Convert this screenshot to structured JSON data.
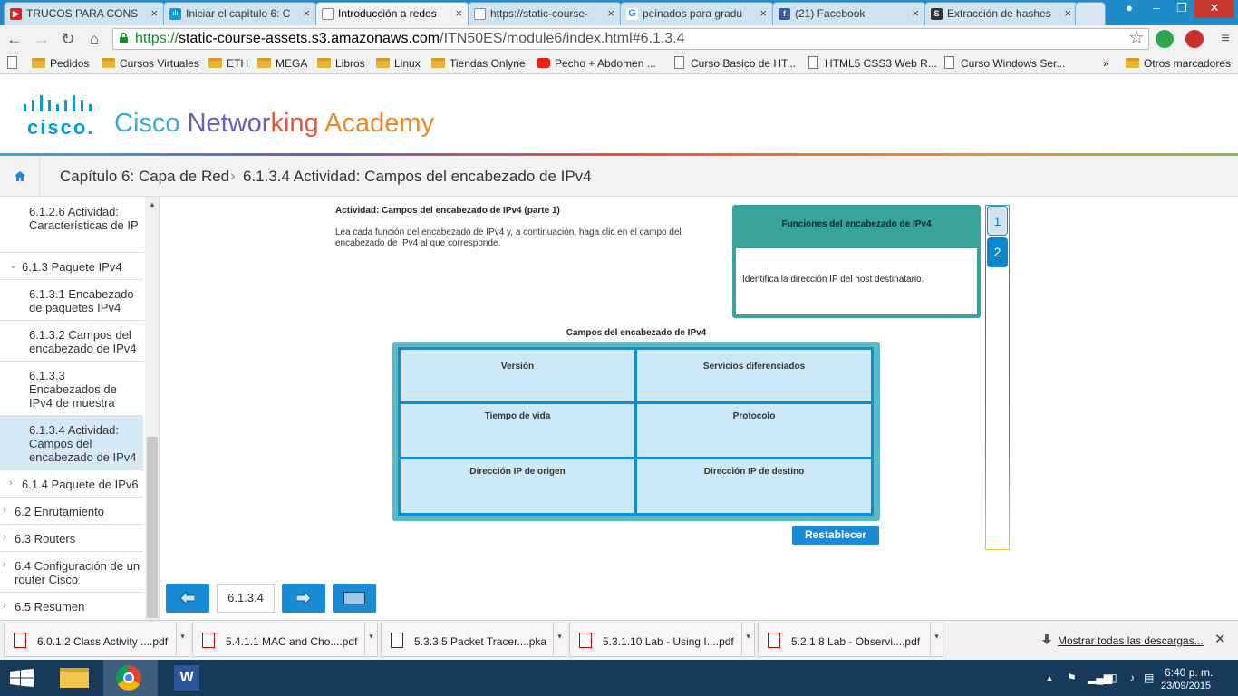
{
  "tabs": [
    {
      "label": "TRUCOS PARA CONS",
      "icon": "youtube-icon"
    },
    {
      "label": "Iniciar el capítulo 6: C",
      "icon": "cisco-icon"
    },
    {
      "label": "Introducción a redes",
      "icon": "page-icon"
    },
    {
      "label": "https://static-course-",
      "icon": "page-icon"
    },
    {
      "label": "peinados para gradu",
      "icon": "google-icon"
    },
    {
      "label": "(21) Facebook",
      "icon": "facebook-icon"
    },
    {
      "label": "Extracción de hashes",
      "icon": "s-icon"
    }
  ],
  "address": {
    "scheme": "https://",
    "host": "static-course-assets.s3.amazonaws.com",
    "path": "/ITN50ES/module6/index.html#6.1.3.4"
  },
  "bookmarks": [
    "Pedidos",
    "Cursos Virtuales",
    "ETH",
    "MEGA",
    "Libros",
    "Linux",
    "Tiendas Onlyne",
    "Pecho + Abdomen ...",
    "Curso Basico de HT...",
    "HTML5 CSS3 Web R...",
    "Curso Windows Ser...",
    "»",
    "Otros marcadores"
  ],
  "header": {
    "logo_text": "cisco.",
    "title_parts": [
      "Cisco ",
      "Networ",
      "king ",
      "Academy"
    ]
  },
  "breadcrumb": {
    "chapter": "Capítulo 6: Capa de Red",
    "separator": "›",
    "current": "6.1.3.4 Actividad: Campos del encabezado de IPv4"
  },
  "sidebar": [
    {
      "label": "6.1.2.6 Actividad: Características de IP",
      "level": 2
    },
    {
      "label": "6.1.3 Paquete IPv4",
      "level": 1,
      "chevron": "⌄"
    },
    {
      "label": "6.1.3.1 Encabezado de paquetes IPv4",
      "level": 2
    },
    {
      "label": "6.1.3.2 Campos del encabezado de IPv4",
      "level": 2
    },
    {
      "label": "6.1.3.3 Encabezados de IPv4 de muestra",
      "level": 2
    },
    {
      "label": "6.1.3.4 Actividad: Campos del encabezado de IPv4",
      "level": 2,
      "active": true
    },
    {
      "label": "6.1.4 Paquete de IPv6",
      "level": 1,
      "chevron": "›"
    },
    {
      "label": "6.2 Enrutamiento",
      "level": 0,
      "chevron": "›"
    },
    {
      "label": "6.3 Routers",
      "level": 0,
      "chevron": "›"
    },
    {
      "label": "6.4 Configuración de un router Cisco",
      "level": 0,
      "chevron": "›"
    },
    {
      "label": "6.5 Resumen",
      "level": 0,
      "chevron": "›"
    }
  ],
  "activity": {
    "title": "Actividad: Campos del encabezado de IPv4 (parte 1)",
    "instructions": "Lea cada función del encabezado de IPv4 y, a continuación, haga clic en el campo del encabezado de IPv4 al que corresponde.",
    "function_heading": "Funciones del encabezado de IPv4",
    "function_text": "Identifica la dirección IP del host destinatario.",
    "pages": [
      "1",
      "2"
    ],
    "grid_title": "Campos del encabezado de IPv4",
    "fields": [
      "Versión",
      "Servicios diferenciados",
      "Tiempo de vida",
      "Protocolo",
      "Dirección IP de origen",
      "Dirección IP de destino"
    ],
    "reset_label": "Restablecer"
  },
  "nav": {
    "page_number": "6.1.3.4"
  },
  "downloads": {
    "items": [
      "6.0.1.2 Class Activity ....pdf",
      "5.4.1.1 MAC and Cho....pdf",
      "5.3.3.5 Packet Tracer....pka",
      "5.3.1.10 Lab - Using I....pdf",
      "5.2.1.8 Lab - Observi....pdf"
    ],
    "show_all": "Mostrar todas las descargas...",
    "close": "✕"
  },
  "taskbar": {
    "time": "6:40 p. m.",
    "date": "23/09/2015"
  },
  "colors": {
    "cisco_blue": "#049fd9",
    "accent": "#1a8ad4",
    "teal": "#38a39a",
    "title_blue": "#3ea8d8",
    "title_violet": "#6a5fb5",
    "title_orange": "#e98b2a",
    "title_green": "#8cc04b"
  }
}
